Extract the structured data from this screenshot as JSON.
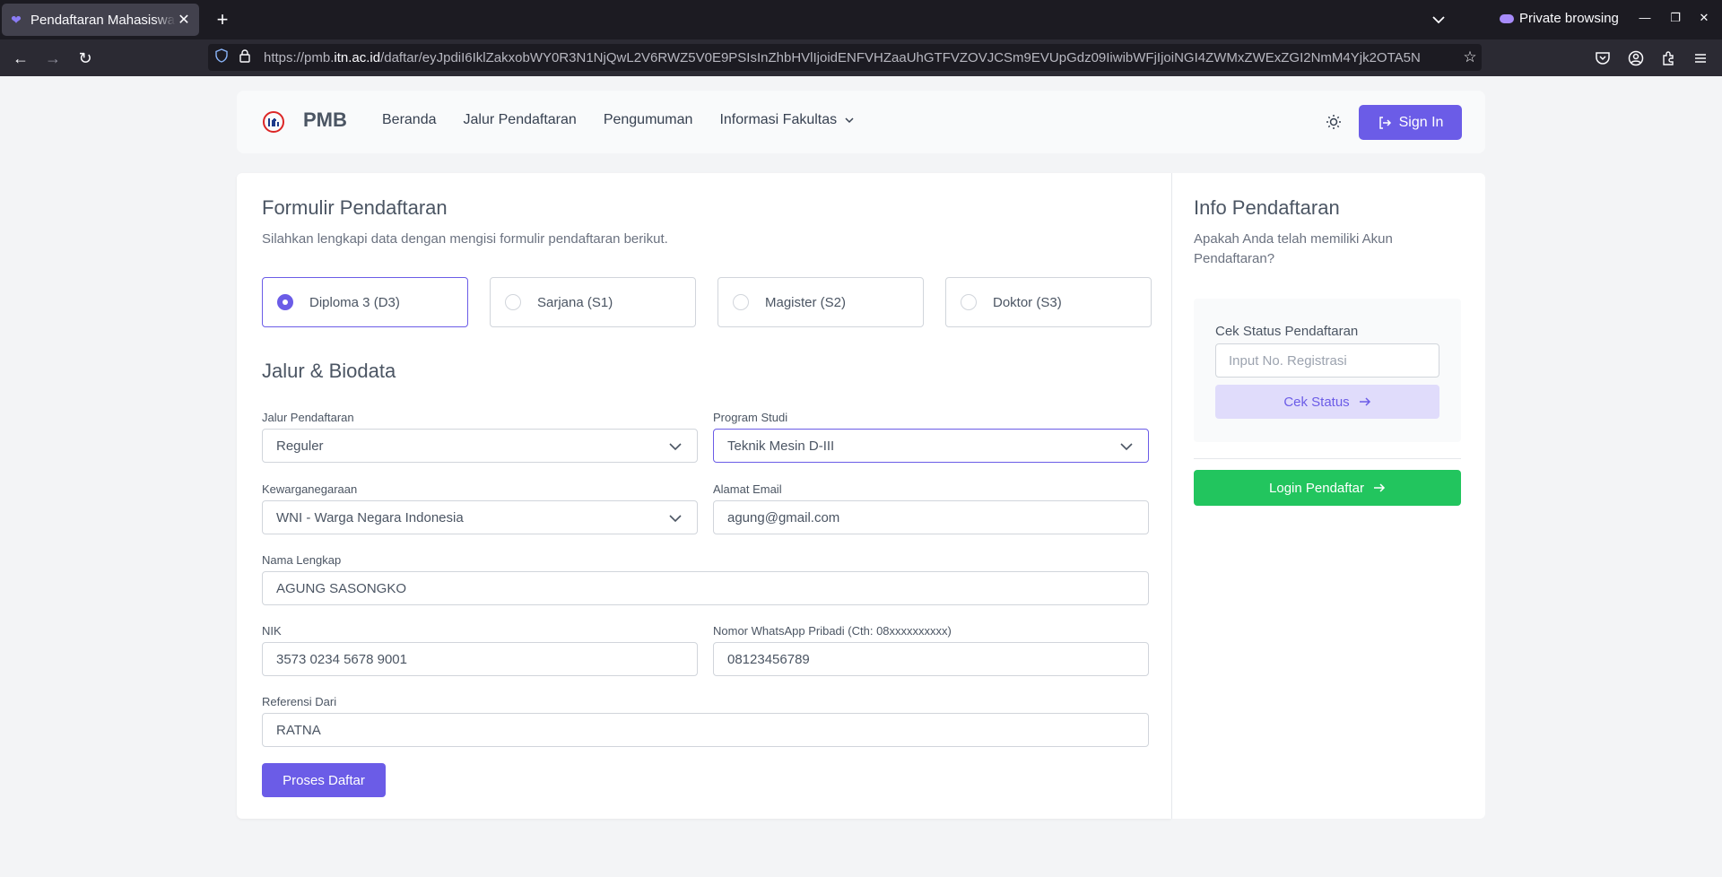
{
  "browser": {
    "tab_title": "Pendaftaran Mahasiswa Baru",
    "new_tab": "+",
    "private_label": "Private browsing",
    "url_prefix": "https://pmb.",
    "url_domain": "itn.ac.id",
    "url_path": "/daftar/eyJpdiI6IklZakxobWY0R3N1NjQwL2V6RWZ5V0E9PSIsInZhbHVlIjoidENFVHZaaUhGTFVZOVJCSm9EVUpGdz09IiwibWFjIjoiNGI4ZWMxZWExZGI2NmM4Yjk2OTA5N"
  },
  "header": {
    "brand": "PMB",
    "menu": [
      "Beranda",
      "Jalur Pendaftaran",
      "Pengumuman",
      "Informasi Fakultas"
    ],
    "signin_label": "Sign In"
  },
  "form": {
    "title": "Formulir Pendaftaran",
    "subtitle": "Silahkan lengkapi data dengan mengisi formulir pendaftaran berikut.",
    "education_levels": [
      "Diploma 3 (D3)",
      "Sarjana (S1)",
      "Magister (S2)",
      "Doktor (S3)"
    ],
    "selected_level": "Diploma 3 (D3)",
    "section_title": "Jalur & Biodata",
    "fields": {
      "jalur": {
        "label": "Jalur Pendaftaran",
        "value": "Reguler"
      },
      "prodi": {
        "label": "Program Studi",
        "value": "Teknik Mesin D-III"
      },
      "kewarganegaraan": {
        "label": "Kewarganegaraan",
        "value": "WNI - Warga Negara Indonesia"
      },
      "email": {
        "label": "Alamat Email",
        "value": "agung@gmail.com"
      },
      "nama": {
        "label": "Nama Lengkap",
        "value": "AGUNG SASONGKO"
      },
      "nik": {
        "label": "NIK",
        "value": "3573 0234 5678 9001"
      },
      "wa": {
        "label": "Nomor WhatsApp Pribadi (Cth: 08xxxxxxxxxx)",
        "value": "08123456789"
      },
      "referensi": {
        "label": "Referensi Dari",
        "value": "RATNA"
      }
    },
    "submit_label": "Proses Daftar"
  },
  "info": {
    "title": "Info Pendaftaran",
    "subtitle": "Apakah Anda telah memiliki Akun Pendaftaran?",
    "cek_label": "Cek Status Pendaftaran",
    "cek_placeholder": "Input No. Registrasi",
    "cek_button": "Cek Status",
    "login_button": "Login Pendaftar"
  },
  "colors": {
    "primary": "#6b5ce7",
    "success": "#22c55e",
    "focus_border": "#6b5ce7"
  },
  "icons": [
    "search-icon"
  ]
}
